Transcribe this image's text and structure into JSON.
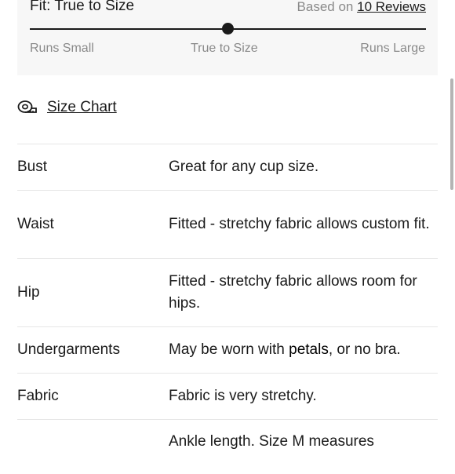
{
  "fit": {
    "title": "Fit: True to Size",
    "based_on_prefix": "Based on",
    "reviews_link": "10 Reviews",
    "scale": {
      "left": "Runs Small",
      "middle": "True to Size",
      "right": "Large",
      "right_prefix": "Runs"
    },
    "value_fraction": 0.5
  },
  "size_chart": {
    "label": "Size Chart",
    "icon": "measuring-tape-icon"
  },
  "details": [
    {
      "label": "Bust",
      "value": "Great for any cup size."
    },
    {
      "label": "Waist",
      "value": "Fitted - stretchy fabric allows custom fit."
    },
    {
      "label": "Hip",
      "value": "Fitted - stretchy fabric allows room for hips."
    },
    {
      "label": "Undergarments",
      "value_before": "May be worn with",
      "value_emph": "petals",
      "value_after": ", or no bra."
    },
    {
      "label": "Fabric",
      "value": "Fabric is very stretchy."
    },
    {
      "label": "",
      "value": "Ankle length. Size M measures"
    }
  ]
}
